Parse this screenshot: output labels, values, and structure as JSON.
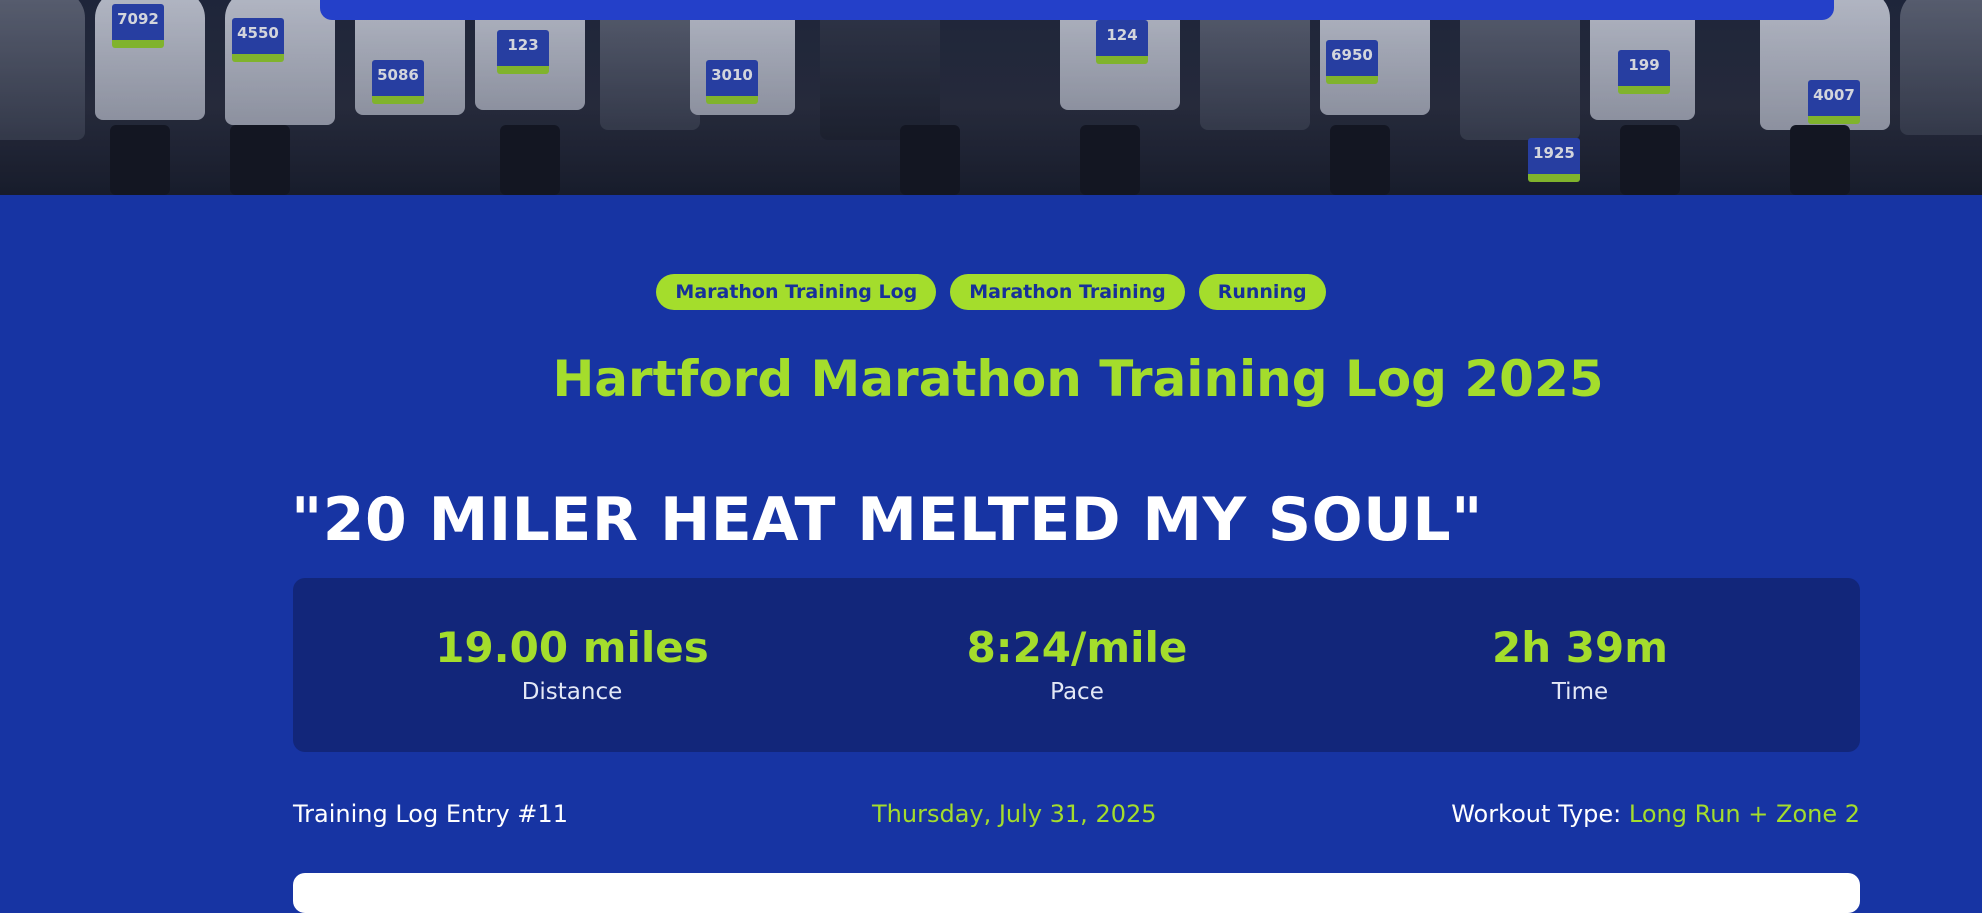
{
  "tags": [
    "Marathon Training Log",
    "Marathon Training",
    "Running"
  ],
  "page_title": "Hartford Marathon Training Log 2025",
  "post_title": "\"20 MILER HEAT MELTED MY SOUL\"",
  "stats": {
    "distance": {
      "value": "19.00 miles",
      "label": "Distance"
    },
    "pace": {
      "value": "8:24/mile",
      "label": "Pace"
    },
    "time": {
      "value": "2h 39m",
      "label": "Time"
    }
  },
  "meta": {
    "entry": "Training Log Entry #11",
    "date": "Thursday, July 31, 2025",
    "workout_type_label": "Workout Type:",
    "workout_type_value": "Long Run + Zone 2"
  },
  "hero": {
    "bibs": [
      "7092",
      "4550",
      "5086",
      "123",
      "3010",
      "124",
      "6950",
      "1925",
      "199",
      "4007"
    ]
  },
  "colors": {
    "background": "#1734a3",
    "accent": "#a4dd2c",
    "card": "#12267a",
    "tag_text": "#17309a"
  }
}
